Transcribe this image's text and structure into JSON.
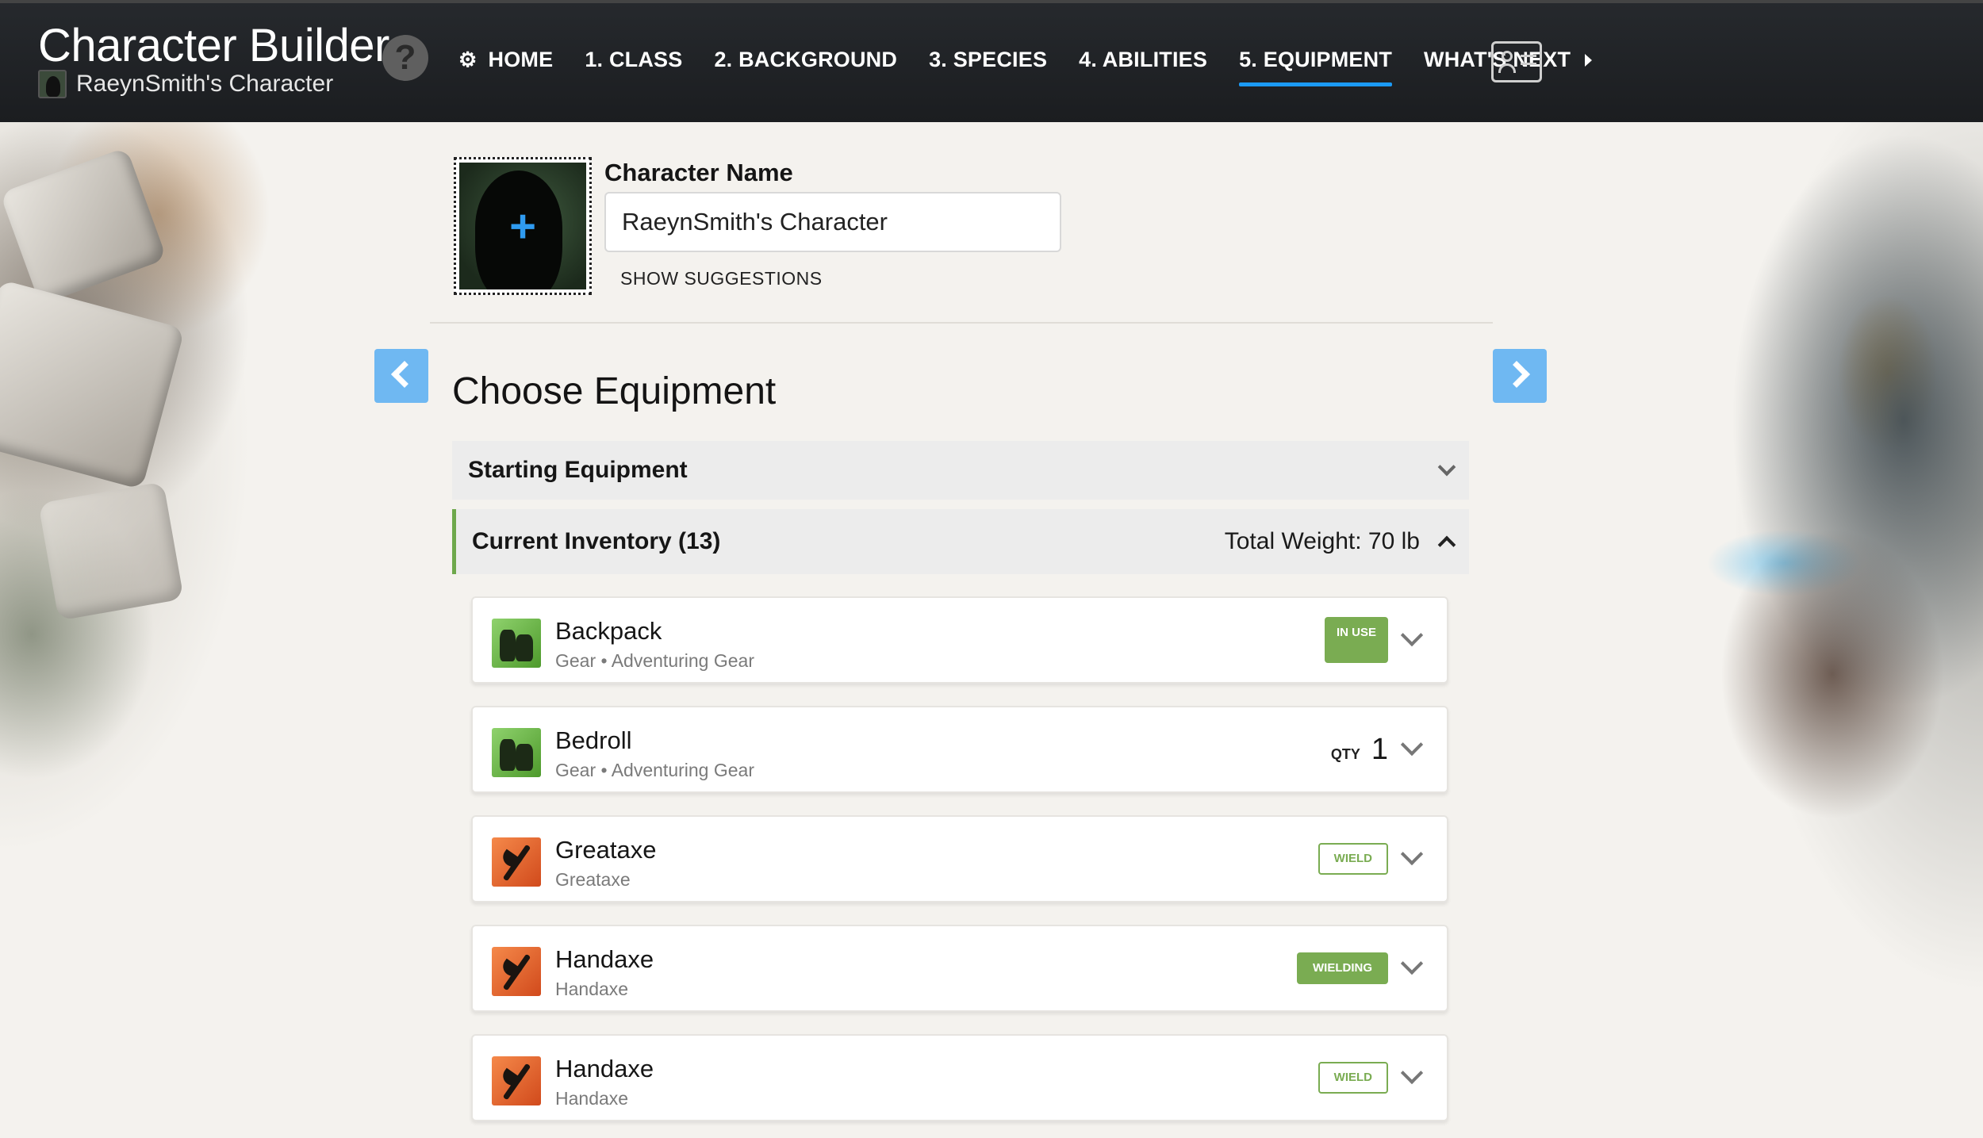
{
  "app": {
    "title": "Character Builder",
    "character_name": "RaeynSmith's Character",
    "help_label": "?"
  },
  "nav": {
    "items": [
      {
        "label": "HOME",
        "icon": "gear-icon"
      },
      {
        "label": "1. CLASS"
      },
      {
        "label": "2. BACKGROUND"
      },
      {
        "label": "3. SPECIES"
      },
      {
        "label": "4. ABILITIES"
      },
      {
        "label": "5. EQUIPMENT",
        "active": true
      },
      {
        "label": "WHAT'S NEXT",
        "icon": "caret-right-icon"
      }
    ],
    "sheet_icon": "character-sheet-icon"
  },
  "character": {
    "name_label": "Character Name",
    "name_value": "RaeynSmith's Character",
    "show_suggestions": "SHOW SUGGESTIONS",
    "portrait_icon": "plus-icon"
  },
  "page": {
    "title": "Choose Equipment",
    "prev_icon": "chevron-left-icon",
    "next_icon": "chevron-right-icon"
  },
  "sections": {
    "starting": {
      "title": "Starting Equipment"
    },
    "inventory": {
      "title": "Current Inventory (13)",
      "total_weight": "Total Weight: 70 lb"
    }
  },
  "inventory": [
    {
      "name": "Backpack",
      "type": "Gear",
      "subtype": "Adventuring Gear",
      "status": "IN USE",
      "icon": "gear-bottles-icon"
    },
    {
      "name": "Bedroll",
      "type": "Gear",
      "subtype": "Adventuring Gear",
      "qty_label": "QTY",
      "qty": "1",
      "icon": "gear-bottles-icon"
    },
    {
      "name": "Greataxe",
      "type": "Greataxe",
      "status": "WIELD",
      "icon": "weapon-axe-icon"
    },
    {
      "name": "Handaxe",
      "type": "Handaxe",
      "status": "WIELDING",
      "icon": "weapon-axe-icon"
    },
    {
      "name": "Handaxe",
      "type": "Handaxe",
      "status": "WIELD",
      "icon": "weapon-axe-icon"
    }
  ],
  "colors": {
    "accent_blue": "#1b9af7",
    "arrow_blue": "#6fb8f2",
    "status_green": "#7aac52",
    "topbar": "#1f2124"
  }
}
